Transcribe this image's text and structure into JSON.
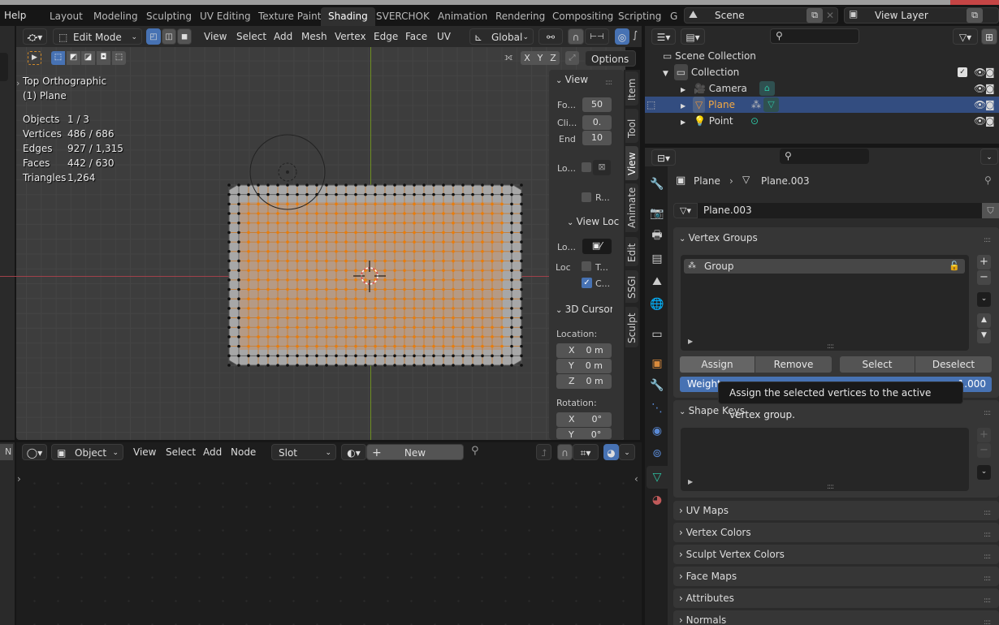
{
  "topbar": {
    "help_menu": "Help",
    "workspace_tabs": [
      "Layout",
      "Modeling",
      "Sculpting",
      "UV Editing",
      "Texture Paint",
      "Shading",
      "SVERCHOK",
      "Animation",
      "Rendering",
      "Compositing",
      "Scripting",
      "G"
    ],
    "active_tab": "Shading",
    "scene": "Scene",
    "view_layer": "View Layer"
  },
  "viewport": {
    "mode": "Edit Mode",
    "menus": [
      "View",
      "Select",
      "Add",
      "Mesh",
      "Vertex",
      "Edge",
      "Face",
      "UV"
    ],
    "transform_orientation": "Global",
    "axis_buttons": [
      "X",
      "Y",
      "Z"
    ],
    "options_label": "Options",
    "view_name": "Top Orthographic",
    "object_name": "(1) Plane",
    "stats": [
      {
        "label": "Objects",
        "value": "1 / 3"
      },
      {
        "label": "Vertices",
        "value": "486 / 686"
      },
      {
        "label": "Edges",
        "value": "927 / 1,315"
      },
      {
        "label": "Faces",
        "value": "442 / 630"
      },
      {
        "label": "Triangles",
        "value": "1,264"
      }
    ],
    "colors": {
      "selected_vertex": "#e87d0d",
      "axis_x": "#a0414a",
      "axis_y": "#6e8f22"
    }
  },
  "npanel": {
    "view_header": "View",
    "focal_label": "Fo...",
    "focal_value": "50",
    "clip_label": "Cli...",
    "clip_value": "0.",
    "end_label": "End",
    "end_value": "10",
    "lock_label": "Lo...",
    "r_label": "R...",
    "view_lock_header": "View Loc",
    "lock_obj_label": "Lo...",
    "loc_label": "Loc",
    "t_label": "T...",
    "c_label": "C...",
    "c_checked": true,
    "cursor_header": "3D Cursor",
    "location_label": "Location:",
    "location": [
      {
        "axis": "X",
        "value": "0 m"
      },
      {
        "axis": "Y",
        "value": "0 m"
      },
      {
        "axis": "Z",
        "value": "0 m"
      }
    ],
    "rotation_label": "Rotation:",
    "rotation": [
      {
        "axis": "X",
        "value": "0°"
      },
      {
        "axis": "Y",
        "value": "0°"
      }
    ],
    "tabs": [
      "Item",
      "Tool",
      "View",
      "Animate",
      "Edit",
      "SSGI",
      "Sculpt"
    ],
    "active_tab": "View"
  },
  "node_editor": {
    "editor_type": "Object",
    "menus": [
      "View",
      "Select",
      "Add",
      "Node"
    ],
    "slot": "Slot",
    "new_label": "New",
    "left_label": "N"
  },
  "outliner": {
    "scene_collection": "Scene Collection",
    "collection": "Collection",
    "items": [
      {
        "name": "Camera",
        "selected": false
      },
      {
        "name": "Plane",
        "selected": true
      },
      {
        "name": "Point",
        "selected": false
      }
    ]
  },
  "properties": {
    "breadcrumb_object": "Plane",
    "breadcrumb_data": "Plane.003",
    "mesh_name": "Plane.003",
    "vertex_groups_header": "Vertex Groups",
    "vertex_groups": [
      "Group"
    ],
    "assign": "Assign",
    "remove": "Remove",
    "select": "Select",
    "deselect": "Deselect",
    "weight_label": "Weight",
    "weight_value": "1.000",
    "tooltip": "Assign the selected vertices to the active vertex group.",
    "shape_keys_header": "Shape Keys",
    "collapsed_panels": [
      "UV Maps",
      "Vertex Colors",
      "Sculpt Vertex Colors",
      "Face Maps",
      "Attributes",
      "Normals"
    ]
  }
}
